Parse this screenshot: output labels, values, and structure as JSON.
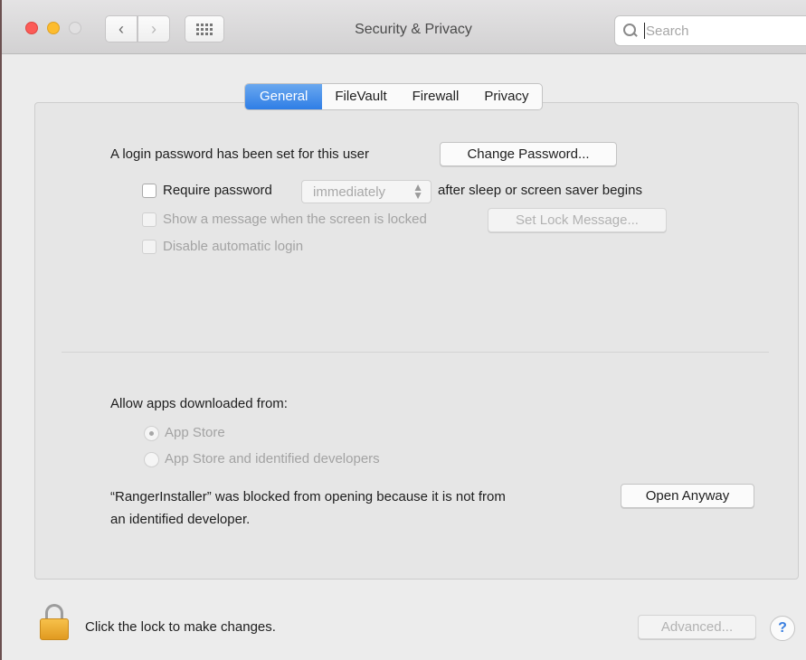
{
  "window": {
    "title": "Security & Privacy"
  },
  "toolbar": {
    "back_icon": "chevron-left-icon",
    "forward_icon": "chevron-right-icon",
    "grid_icon": "show-all-grid-icon",
    "search_placeholder": "Search",
    "search_value": ""
  },
  "tabs": [
    {
      "label": "General",
      "active": true
    },
    {
      "label": "FileVault",
      "active": false
    },
    {
      "label": "Firewall",
      "active": false
    },
    {
      "label": "Privacy",
      "active": false
    }
  ],
  "general": {
    "password_status": "A login password has been set for this user",
    "change_password_label": "Change Password...",
    "require_password_label": "Require password",
    "require_password_value": "immediately",
    "require_password_suffix": "after sleep or screen saver begins",
    "show_message_label": "Show a message when the screen is locked",
    "set_lock_message_label": "Set Lock Message...",
    "disable_auto_login_label": "Disable automatic login"
  },
  "apps": {
    "heading": "Allow apps downloaded from:",
    "option_app_store": "App Store",
    "option_identified": "App Store and identified developers",
    "selected": "App Store",
    "blocked_message_line1": "“RangerInstaller” was blocked from opening because it is not from",
    "blocked_message_line2": "an identified developer.",
    "open_anyway_label": "Open Anyway"
  },
  "footer": {
    "lock_text": "Click the lock to make changes.",
    "advanced_label": "Advanced...",
    "help_label": "?"
  },
  "colors": {
    "accent": "#2f7ee6",
    "lock": "#f2b33d",
    "close": "#fc5b57",
    "minimize": "#fdbc2e"
  }
}
